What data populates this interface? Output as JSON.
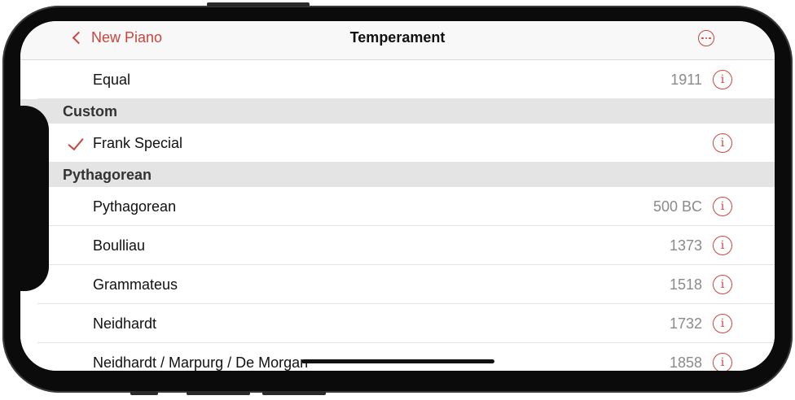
{
  "nav": {
    "back_label": "New Piano",
    "title": "Temperament",
    "more_icon": "ellipsis-circle-icon"
  },
  "sections": [
    {
      "header": "",
      "rows": [
        {
          "label": "Equal",
          "value": "1911",
          "checked": false
        }
      ]
    },
    {
      "header": "Custom",
      "rows": [
        {
          "label": "Frank Special",
          "value": "",
          "checked": true
        }
      ]
    },
    {
      "header": "Pythagorean",
      "rows": [
        {
          "label": "Pythagorean",
          "value": "500 BC",
          "checked": false
        },
        {
          "label": "Boulliau",
          "value": "1373",
          "checked": false
        },
        {
          "label": "Grammateus",
          "value": "1518",
          "checked": false
        },
        {
          "label": "Neidhardt",
          "value": "1732",
          "checked": false
        },
        {
          "label": "Neidhardt / Marpurg / De Morgan",
          "value": "1858",
          "checked": false
        }
      ]
    }
  ],
  "info_icon_glyph": "i",
  "colors": {
    "accent": "#c8463d",
    "section_bg": "#e4e4e4",
    "secondary_text": "#8a8a8a"
  }
}
